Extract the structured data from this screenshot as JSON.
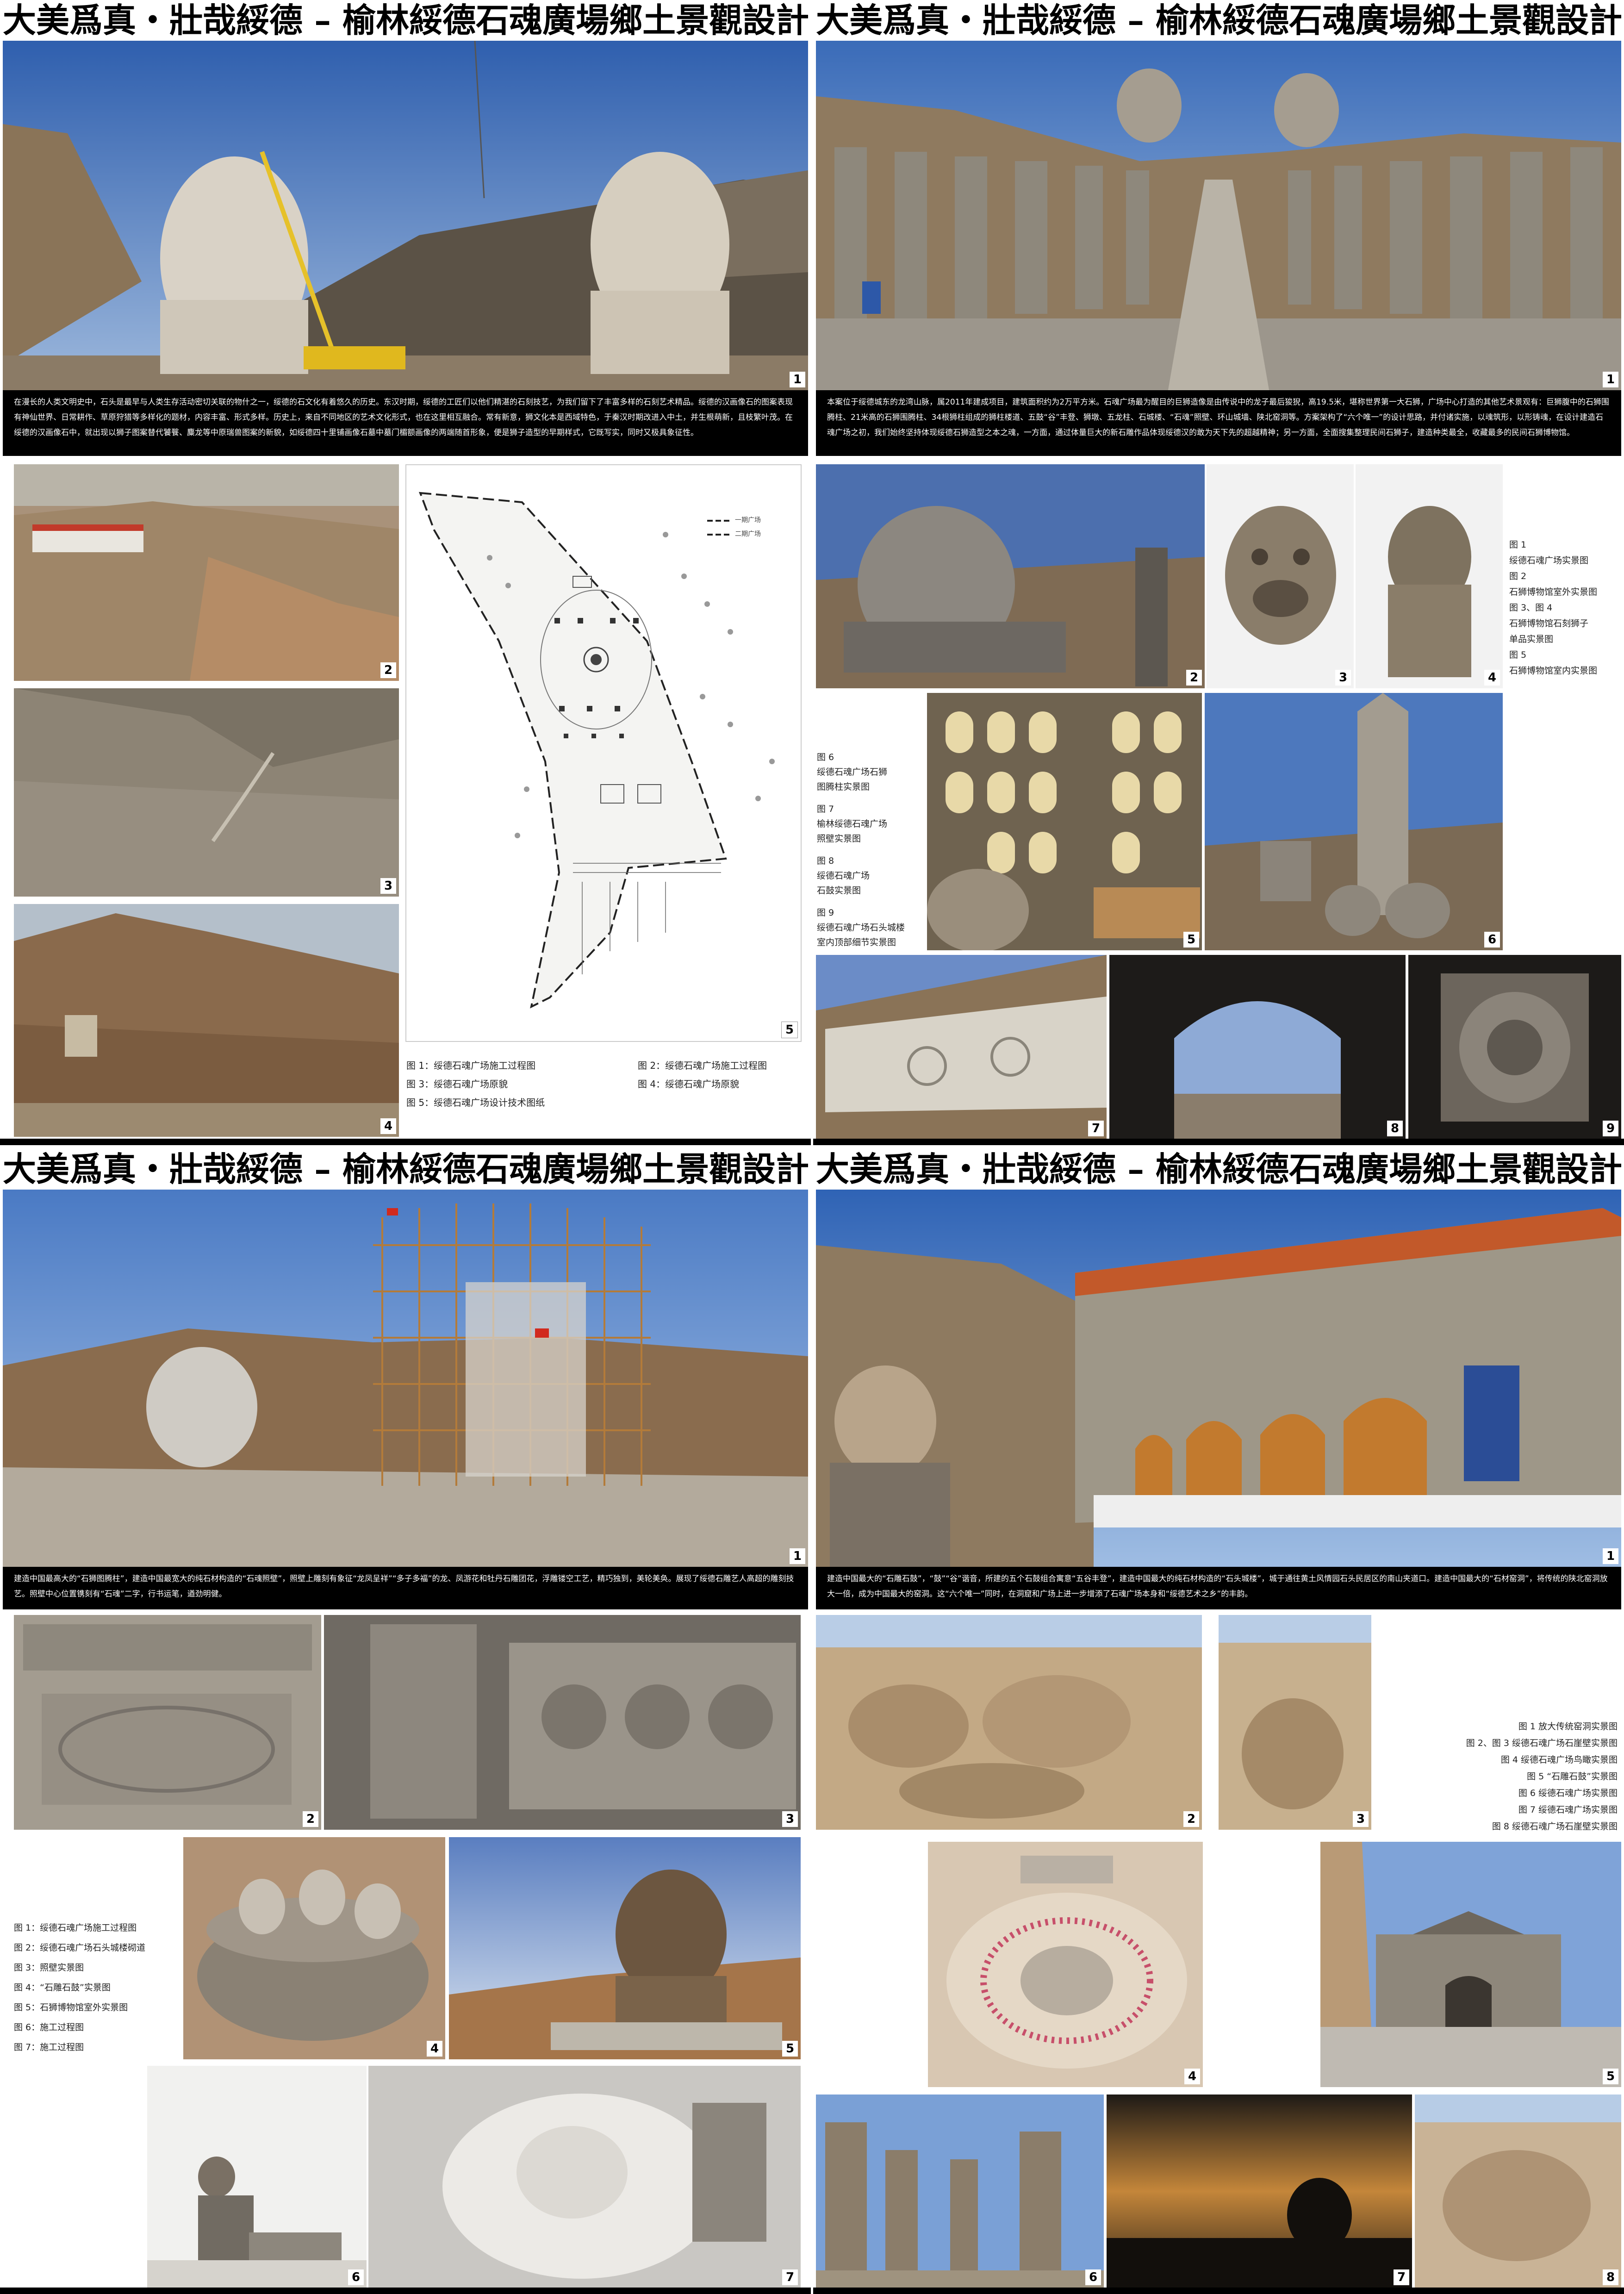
{
  "page_title": "大美爲真・壯哉綏德 – 榆林綏德石魂廣場鄉土景觀設計",
  "boards": [
    {
      "description": "在漫长的人类文明史中，石头是最早与人类生存活动密切关联的物什之一，绥德的石文化有着悠久的历史。东汉时期，绥德的工匠们以他们精湛的石刻技艺，为我们留下了丰富多样的石刻艺术精品。绥德的汉画像石的图案表现有神仙世界、日常耕作、草原狩猎等多样化的题材，内容丰富、形式多样。历史上，来自不同地区的艺术文化形式，也在这里相互融合。常有新意，狮文化本是西域特色，于秦汉时期改进入中土，并生根萌新，且枝繁叶茂。在绥德的汉画像石中，就出现以狮子图案替代饕餮、麋龙等中原瑞兽图案的新貌，如绥德四十里铺画像石墓中墓门楣额画像的两端随首形象，便是狮子造型的早期样式，它既写实，同时又极具象征性。",
      "captions": [
        "图 1：绥德石魂广场施工过程图",
        "图 2：绥德石魂广场施工过程图",
        "图 3：绥德石魂广场原貌",
        "图 4：绥德石魂广场原貌",
        "图 5：绥德石魂广场设计技术图纸"
      ],
      "plan_legend": [
        "一期广场",
        "二期广场"
      ]
    },
    {
      "description": "本案位于绥德城东的龙湾山脉，属2011年建成项目，建筑面积约为2万平方米。石魂广场最为醒目的巨狮造像是由传说中的龙子最后狻猊，高19.5米，堪称世界第一大石狮，广场中心打造的其他艺术景观有：巨狮腹中的石狮围腾柱、21米高的石狮围腾柱、34根狮柱组成的狮柱楼道、五鼓“谷”丰登、狮墩、五龙柱、石城楼、“石魂”照壁、环山城墙、陕北窑洞等。方案架构了“六个唯一”的设计思路，并付诸实施，以魂筑形，以形铸魂，在设计建造石魂广场之初，我们始终坚持体现绥德石狮造型之本之魂，一方面，通过体量巨大的新石雕作品体现绥德汉的敢为天下先的超越精神；另一方面，全面搜集整理民间石狮子，建造种类最全，收藏最多的民间石狮博物馆。",
      "captions": [
        "图 1",
        "绥德石魂广场实景图",
        "图 2",
        "石狮博物馆室外实景图",
        "图 3、图 4",
        "石狮博物馆石刻狮子",
        "单品实景图",
        "图 5",
        "石狮博物馆室内实景图"
      ],
      "captions2": [
        "图 6",
        "绥德石魂广场石狮",
        "图腾柱实景图",
        "图 7",
        "榆林绥德石魂广场",
        "照壁实景图",
        "图 8",
        "绥德石魂广场",
        "石鼓实景图",
        "图 9",
        "绥德石魂广场石头城楼",
        "室内顶部细节实景图"
      ]
    },
    {
      "description": "建造中国最高大的“石狮图腾柱”，建造中国最宽大的纯石材构造的“石魂照壁”，照壁上雕刻有象征“龙凤呈祥”“多子多福”的龙、凤游花和牡丹石雕团花，浮雕镂空工艺，精巧独到，美轮美奂。展现了绥德石雕艺人高超的雕刻技艺。照壁中心位置镌刻有“石魂”二字，行书运笔，遒劲明健。",
      "captions": [
        "图 1：绥德石魂广场施工过程图",
        "图 2：绥德石魂广场石头城楼砌道",
        "图 3：照壁实景图",
        "图 4：“石雕石鼓”实景图",
        "图 5：石狮博物馆室外实景图",
        "图 6：施工过程图",
        "图 7：施工过程图"
      ]
    },
    {
      "description": "建造中国最大的“石雕石鼓”，“鼓”“谷”谐音，所建的五个石鼓组合寓意“五谷丰登”，建造中国最大的纯石材构造的“石头城楼”，城于通往黄土风情园石头民居区的南山夹道口。建造中国最大的“石材窑洞”，将传统的陕北窑洞放大一倍，成为中国最大的窑洞。这“六个唯一”同时，在洞窟和广场上进一步增添了石魂广场本身和“绥德艺术之乡”的丰韵。",
      "captions": [
        "图 1  放大传统窑洞实景图",
        "图 2、图 3  绥德石魂广场石崖壁实景图",
        "图 4  绥德石魂广场鸟瞰实景图",
        "图 5  “石雕石鼓”实景图",
        "图 6  绥德石魂广场实景图",
        "图 7  绥德石魂广场实景图",
        "图 8  绥德石魂广场石崖壁实景图"
      ]
    }
  ],
  "colors": {
    "sky": "#4a74b8",
    "rock": "#a89377",
    "stone": "#b4ada2",
    "earth": "#a07a55",
    "dark": "#1a1a1a"
  }
}
